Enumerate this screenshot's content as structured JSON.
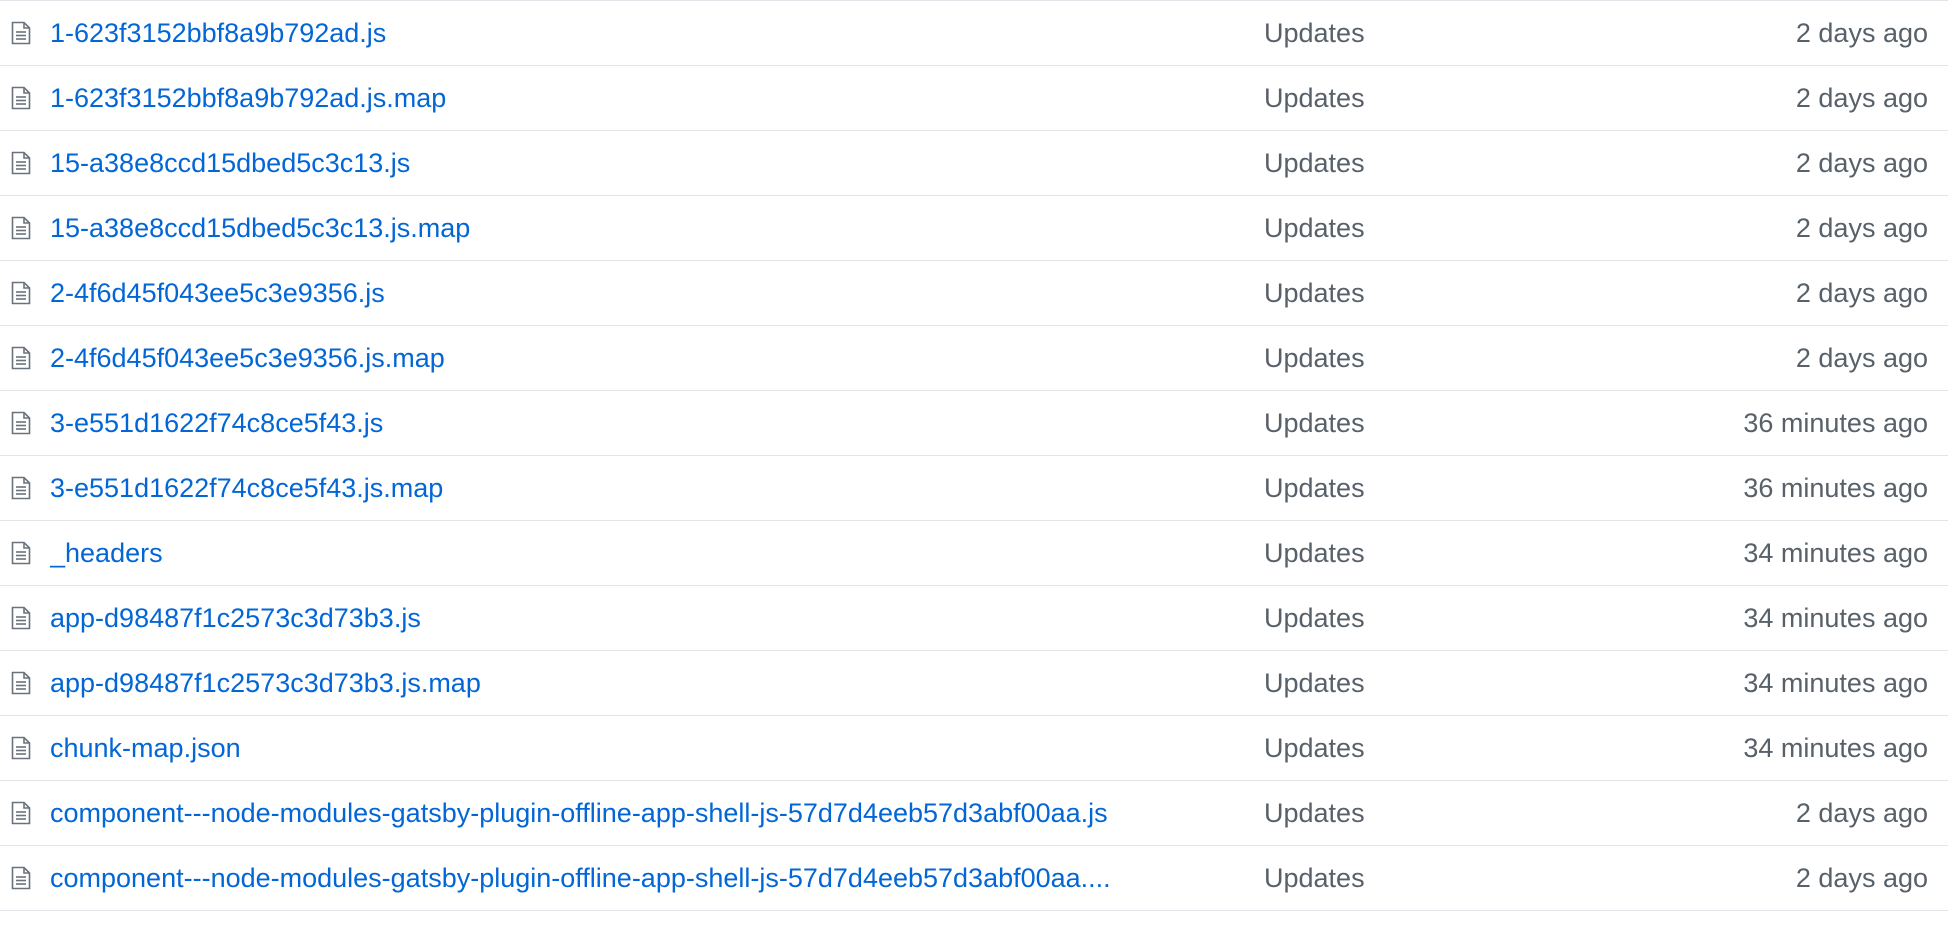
{
  "file_list": {
    "rows": [
      {
        "icon": "file-icon",
        "name": "1-623f3152bbf8a9b792ad.js",
        "message": "Updates",
        "age": "2 days ago"
      },
      {
        "icon": "file-icon",
        "name": "1-623f3152bbf8a9b792ad.js.map",
        "message": "Updates",
        "age": "2 days ago"
      },
      {
        "icon": "file-icon",
        "name": "15-a38e8ccd15dbed5c3c13.js",
        "message": "Updates",
        "age": "2 days ago"
      },
      {
        "icon": "file-icon",
        "name": "15-a38e8ccd15dbed5c3c13.js.map",
        "message": "Updates",
        "age": "2 days ago"
      },
      {
        "icon": "file-icon",
        "name": "2-4f6d45f043ee5c3e9356.js",
        "message": "Updates",
        "age": "2 days ago"
      },
      {
        "icon": "file-icon",
        "name": "2-4f6d45f043ee5c3e9356.js.map",
        "message": "Updates",
        "age": "2 days ago"
      },
      {
        "icon": "file-icon",
        "name": "3-e551d1622f74c8ce5f43.js",
        "message": "Updates",
        "age": "36 minutes ago"
      },
      {
        "icon": "file-icon",
        "name": "3-e551d1622f74c8ce5f43.js.map",
        "message": "Updates",
        "age": "36 minutes ago"
      },
      {
        "icon": "file-icon",
        "name": "_headers",
        "message": "Updates",
        "age": "34 minutes ago"
      },
      {
        "icon": "file-icon",
        "name": "app-d98487f1c2573c3d73b3.js",
        "message": "Updates",
        "age": "34 minutes ago"
      },
      {
        "icon": "file-icon",
        "name": "app-d98487f1c2573c3d73b3.js.map",
        "message": "Updates",
        "age": "34 minutes ago"
      },
      {
        "icon": "file-icon",
        "name": "chunk-map.json",
        "message": "Updates",
        "age": "34 minutes ago"
      },
      {
        "icon": "file-icon",
        "name": "component---node-modules-gatsby-plugin-offline-app-shell-js-57d7d4eeb57d3abf00aa.js",
        "message": "Updates",
        "age": "2 days ago"
      },
      {
        "icon": "file-icon",
        "name": "component---node-modules-gatsby-plugin-offline-app-shell-js-57d7d4eeb57d3abf00aa....",
        "message": "Updates",
        "age": "2 days ago"
      }
    ]
  },
  "colors": {
    "link": "#0366d6",
    "muted_text": "#586069",
    "border": "#e1e4e8",
    "icon": "#6a737d"
  }
}
